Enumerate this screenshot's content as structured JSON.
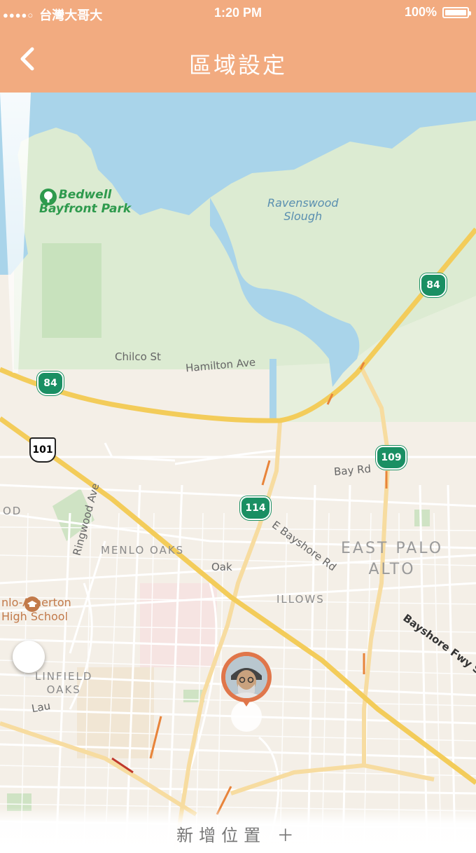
{
  "status": {
    "signal_dots": "●●●●○",
    "carrier": "台灣大哥大",
    "time": "1:20 PM",
    "battery": "100%"
  },
  "nav": {
    "title": "區域設定",
    "back_icon": "chevron-left-icon"
  },
  "map": {
    "streets": {
      "chilco": "Chilco St",
      "hamilton": "Hamilton Ave",
      "bay": "Bay Rd",
      "ringwood": "Ringwood Ave",
      "bayshore_rd": "E Bayshore Rd",
      "bayshore_fwy": "Bayshore Fwy S",
      "oak": "Oak",
      "od": "OD",
      "lau": "Lau"
    },
    "parks": {
      "bedwell": "Bedwell\nBayfront Park"
    },
    "water": {
      "ravenswood": "Ravenswood\nSlough"
    },
    "districts": {
      "menlo_oaks": "MENLO OAKS",
      "willows": "ILLOWS",
      "linfield": "LINFIELD\nOAKS"
    },
    "city": "EAST PALO\nALTO",
    "school": "nlo-Atherton\nHigh School",
    "highways": {
      "h84_top": "84",
      "h84_left": "84",
      "h101": "101",
      "h109": "109",
      "h114": "114"
    }
  },
  "bottom": {
    "add_label": "新增位置 ＋"
  },
  "colors": {
    "header": "#f2ab80",
    "water": "#a9d4ea",
    "park": "#dcebd2",
    "highway": "#f3cc5a",
    "pin": "#e0764a"
  }
}
